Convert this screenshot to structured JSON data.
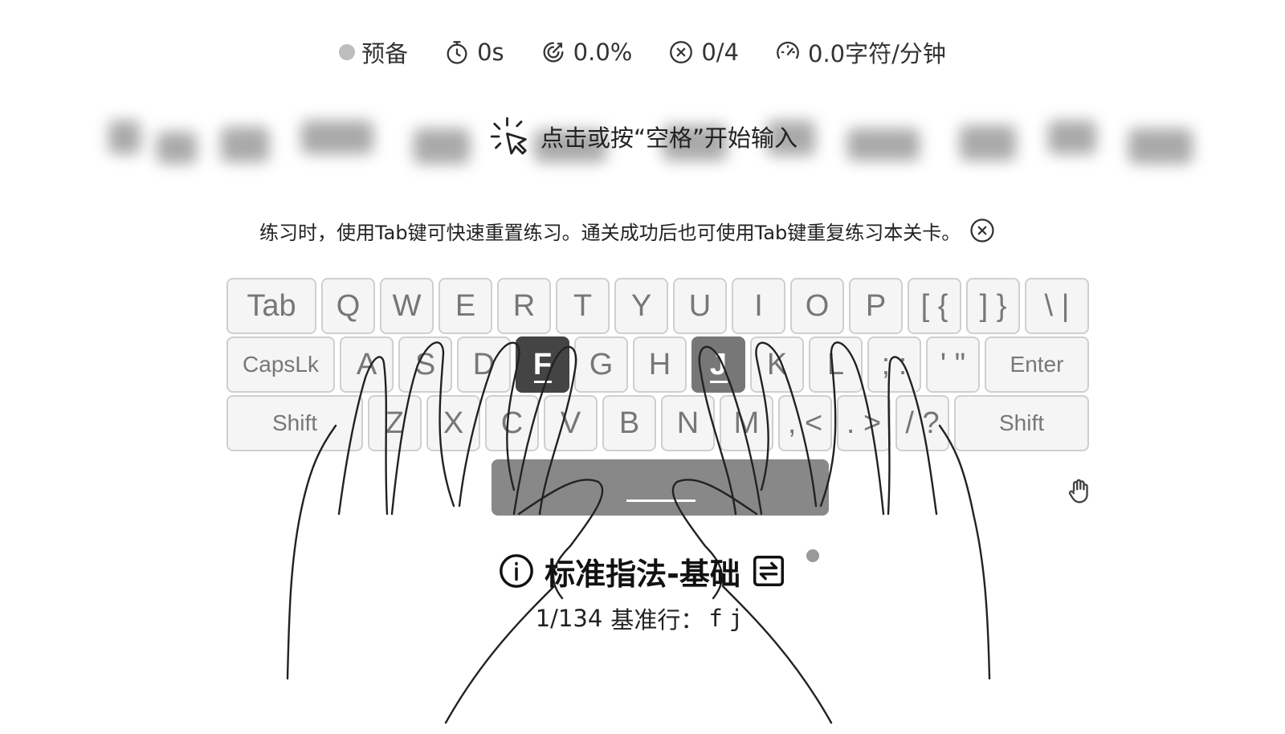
{
  "stats": {
    "status_label": "预备",
    "time": "0s",
    "accuracy": "0.0%",
    "errors": "0/4",
    "speed": "0.0字符/分钟"
  },
  "start_hint": "点击或按“空格”开始输入",
  "tip": "练习时，使用Tab键可快速重置练习。通关成功后也可使用Tab键重复练习本关卡。",
  "keyboard": {
    "row1": [
      "Tab",
      "Q",
      "W",
      "E",
      "R",
      "T",
      "Y",
      "U",
      "I",
      "O",
      "P",
      "[ {",
      "] }",
      "\\ |"
    ],
    "row2": [
      "CapsLk",
      "A",
      "S",
      "D",
      "F",
      "G",
      "H",
      "J",
      "K",
      "L",
      "; :",
      "' \"",
      "Enter"
    ],
    "row3": [
      "Shift",
      "Z",
      "X",
      "C",
      "V",
      "B",
      "N",
      "M",
      ", <",
      ". >",
      "/ ?",
      "Shift"
    ],
    "active_keys": [
      "F",
      "J"
    ]
  },
  "lesson": {
    "title": "标准指法-基础",
    "progress": "1/134",
    "row_label": "基准行：",
    "keys": "fj"
  },
  "colors": {
    "active_key": "#444444",
    "home_key": "#777777",
    "space_key": "#888888"
  },
  "icons": [
    "status-dot",
    "timer-icon",
    "accuracy-icon",
    "error-icon",
    "speed-icon",
    "click-cursor-icon",
    "close-icon",
    "hand-icon",
    "info-icon",
    "switch-icon"
  ]
}
